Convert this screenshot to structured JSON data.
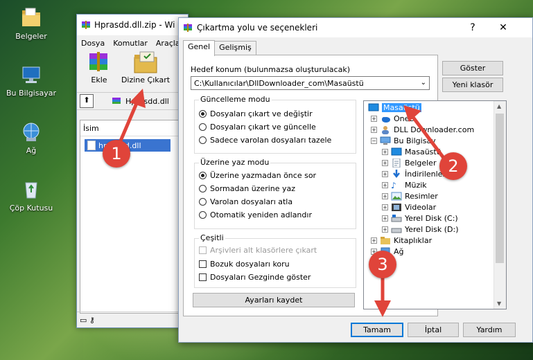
{
  "desktop": {
    "icons": [
      {
        "label": "Belgeler"
      },
      {
        "label": "Bu Bilgisayar"
      },
      {
        "label": "Ağ"
      },
      {
        "label": "Çöp Kutusu"
      }
    ]
  },
  "winrar": {
    "title": "Hprasdd.dll.zip - Wi",
    "menu": [
      "Dosya",
      "Komutlar",
      "Araçla"
    ],
    "tools": [
      {
        "label": "Ekle"
      },
      {
        "label": "Dizine Çıkart"
      }
    ],
    "path": "Hprasdd.dll",
    "list_header": "İsim",
    "file": "hprasdd.dll"
  },
  "dialog": {
    "title": "Çıkartma yolu ve seçenekleri",
    "help": "?",
    "close": "✕",
    "tabs": [
      "Genel",
      "Gelişmiş"
    ],
    "destination_label": "Hedef konum (bulunmazsa oluşturulacak)",
    "destination_value": "C:\\Kullanıcılar\\DllDownloader_com\\Masaüstü",
    "show_button": "Göster",
    "new_folder_button": "Yeni klasör",
    "update_mode": {
      "title": "Güncelleme modu",
      "options": [
        "Dosyaları çıkart ve değiştir",
        "Dosyaları çıkart ve güncelle",
        "Sadece varolan dosyaları tazele"
      ],
      "selected": 0
    },
    "overwrite_mode": {
      "title": "Üzerine yaz modu",
      "options": [
        "Üzerine yazmadan önce sor",
        "Sormadan üzerine yaz",
        "Varolan dosyaları atla",
        "Otomatik yeniden adlandır"
      ],
      "selected": 0
    },
    "misc": {
      "title": "Çeşitli",
      "options": [
        "Arşivleri alt klasörlere çıkart",
        "Bozuk dosyaları koru",
        "Dosyaları Gezginde göster"
      ]
    },
    "save_settings": "Ayarları kaydet",
    "tree": [
      {
        "label": "Masaüstü",
        "selected": true
      },
      {
        "label": "OneD"
      },
      {
        "label": "DLL Downloader.com"
      },
      {
        "label": "Bu Bilgisay"
      },
      {
        "label": "Masaüstü"
      },
      {
        "label": "Belgeler"
      },
      {
        "label": "İndirilenler"
      },
      {
        "label": "Müzik"
      },
      {
        "label": "Resimler"
      },
      {
        "label": "Videolar"
      },
      {
        "label": "Yerel Disk (C:)"
      },
      {
        "label": "Yerel Disk (D:)"
      },
      {
        "label": "Kitaplıklar"
      },
      {
        "label": "Ağ"
      }
    ],
    "ok": "Tamam",
    "cancel": "İptal",
    "help_button": "Yardım"
  },
  "markers": [
    "1",
    "2",
    "3"
  ],
  "colors": {
    "marker": "#e0443a",
    "selection": "#3399ff",
    "default_button": "#0078d7"
  }
}
